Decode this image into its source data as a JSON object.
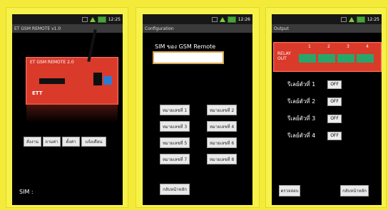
{
  "panel1": {
    "time": "12:25",
    "title": "ET GSM REMOTE v1.0",
    "board_label": "ET GSM REMOTE 2.0",
    "logo": "ETT",
    "buttons": [
      "สั่งงาน",
      "ถามค่า",
      "ตั้งค่า",
      "แจ้งเตือน"
    ],
    "sim_label": "SIM :"
  },
  "panel2": {
    "time": "12:26",
    "title": "Configuration",
    "sim_label": "SIM ของ GSM Remote",
    "sim_value": "",
    "buttons": [
      "หมายเลขที่ 1",
      "หมายเลขที่ 2",
      "หมายเลขที่ 3",
      "หมายเลขที่ 4",
      "หมายเลขที่ 5",
      "หมายเลขที่ 6",
      "หมายเลขที่ 7",
      "หมายเลขที่ 8"
    ],
    "back_button": "กลับหน้าหลัก"
  },
  "panel3": {
    "time": "12:25",
    "title": "Output",
    "relay_header": "RELAY OUT",
    "relay_numbers": [
      "1",
      "2",
      "3",
      "4"
    ],
    "relays": [
      {
        "label": "รีเลย์ตัวที่ 1",
        "state": "OFF"
      },
      {
        "label": "รีเลย์ตัวที่ 2",
        "state": "OFF"
      },
      {
        "label": "รีเลย์ตัวที่ 3",
        "state": "OFF"
      },
      {
        "label": "รีเลย์ตัวที่ 4",
        "state": "OFF"
      }
    ],
    "left_button": "ตรวจสอบ",
    "right_button": "กลับหน้าหลัก"
  }
}
